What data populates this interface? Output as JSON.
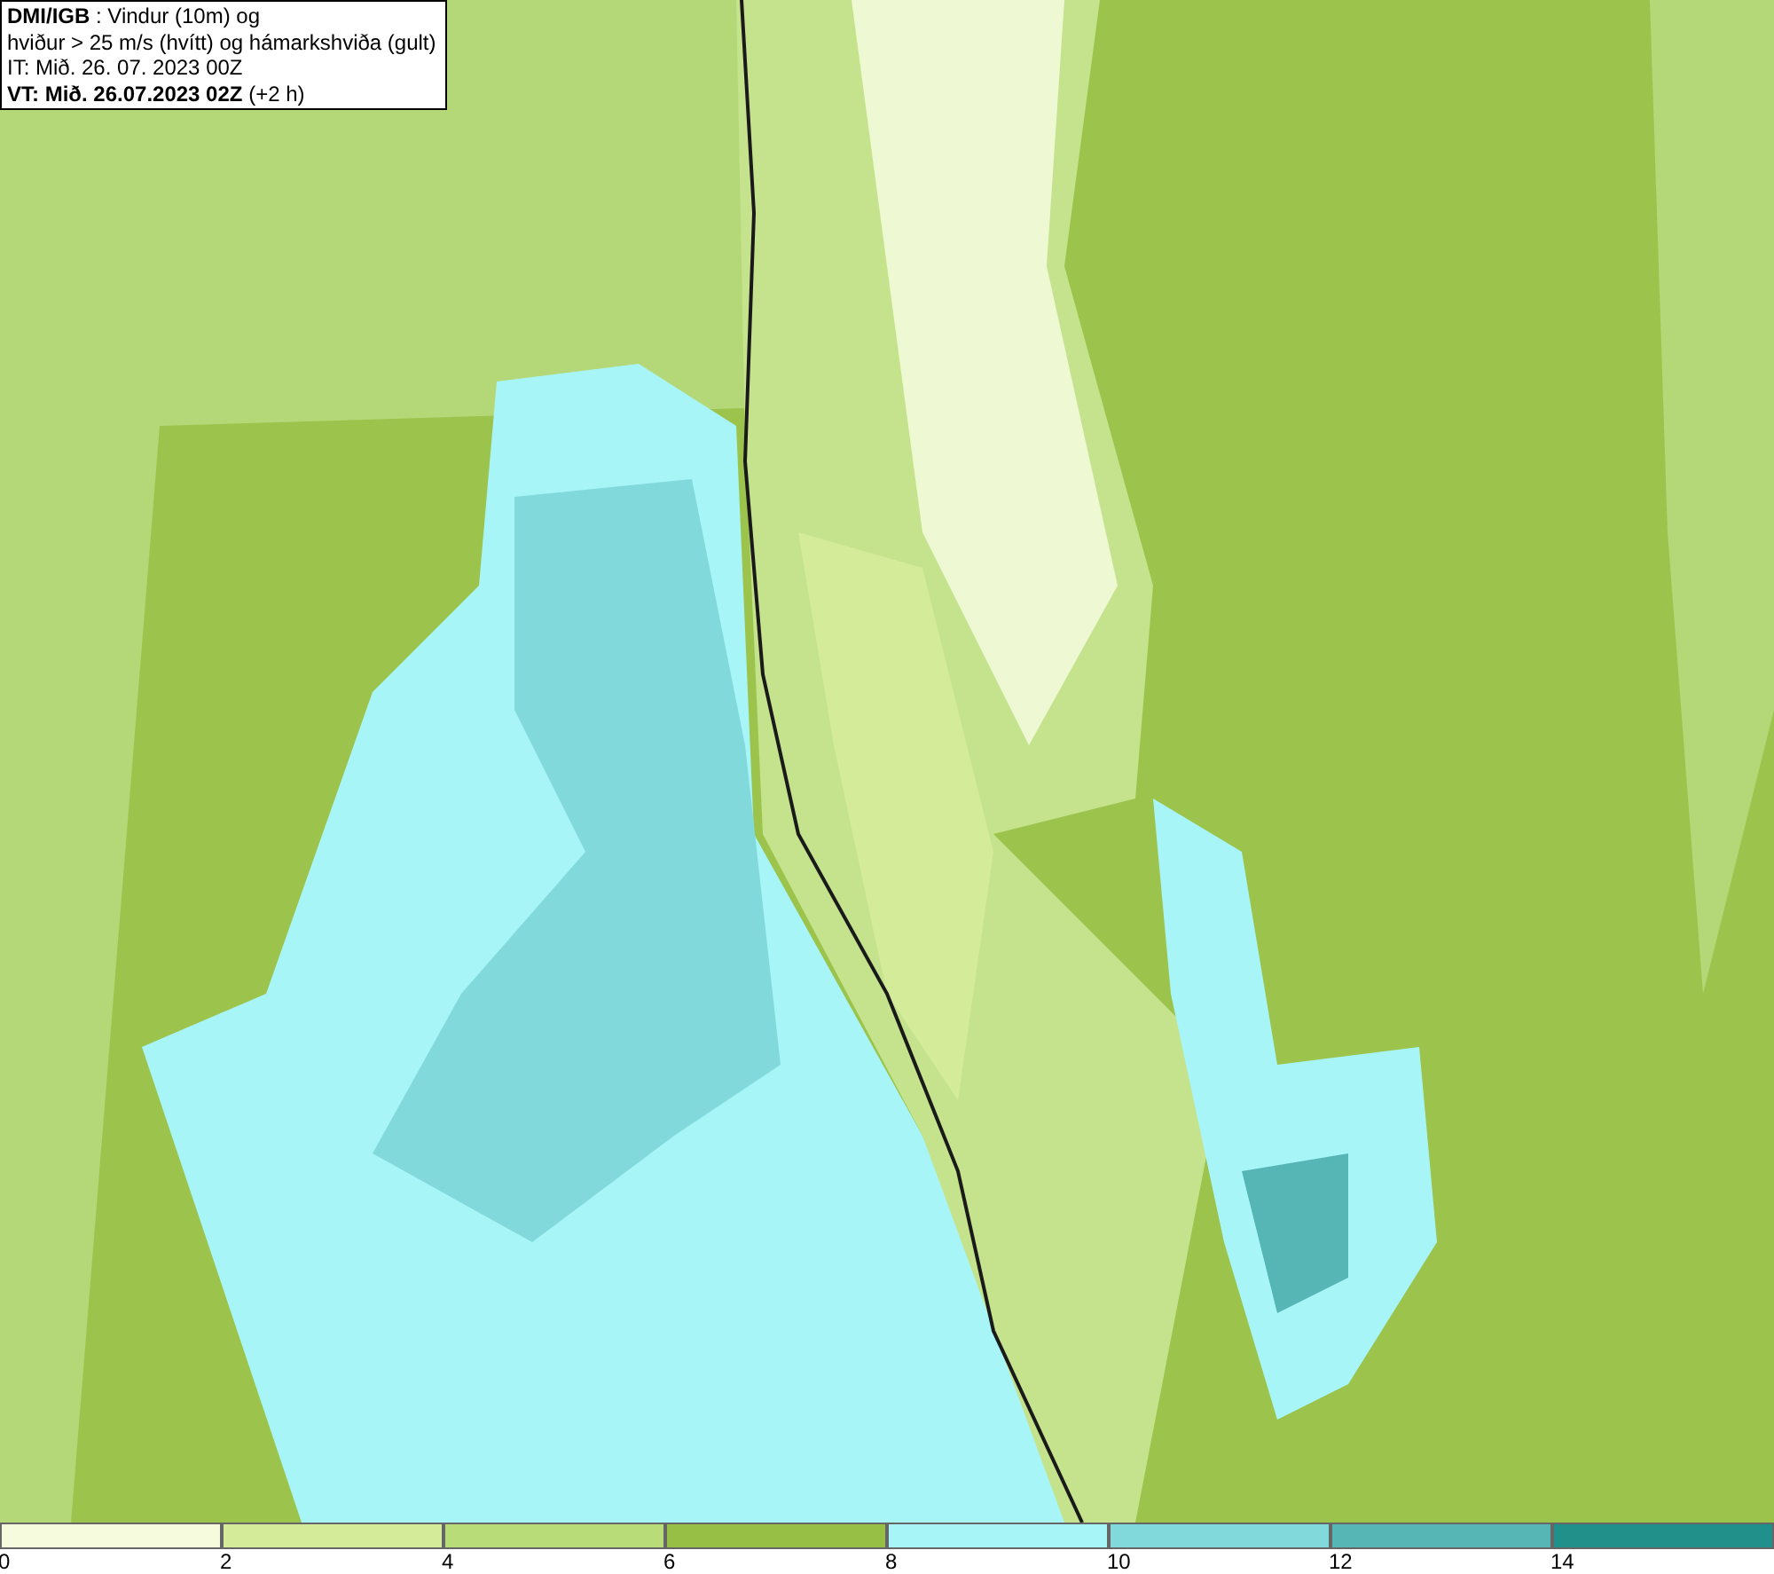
{
  "header": {
    "lines": [
      "**DMI/IGB** : Vindur (10m) og",
      "hviður > 25 m/s (hvítt) og hámarkshviða (gult)",
      "IT: Mið. 26. 07. 2023 00Z",
      "**VT: Mið. 26.07.2023 02Z** (+2 h)"
    ]
  },
  "legend": {
    "bins": [
      {
        "label": "0",
        "color": "#f5fbdc"
      },
      {
        "label": "2",
        "color": "#d4ec9a"
      },
      {
        "label": "4",
        "color": "#b7dc78"
      },
      {
        "label": "6",
        "color": "#97bf45"
      },
      {
        "label": "8",
        "color": "#a8f5f8"
      },
      {
        "label": "10",
        "color": "#82d9dc"
      },
      {
        "label": "12",
        "color": "#56b5b5"
      },
      {
        "label": "14",
        "color": "#21908b"
      }
    ]
  }
}
